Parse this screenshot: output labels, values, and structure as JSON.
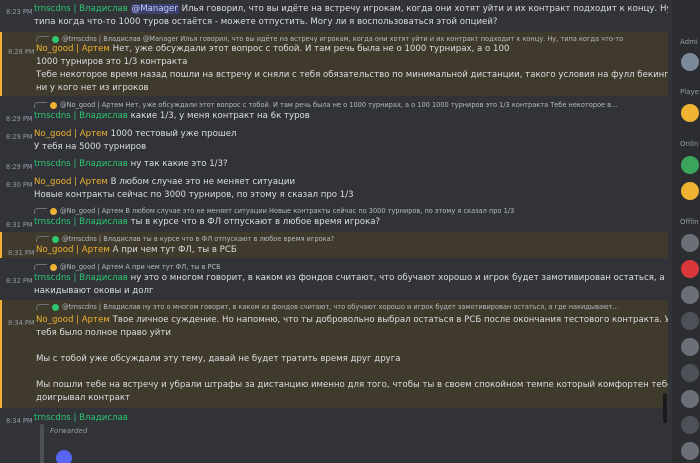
{
  "messages": [
    {
      "time": "8:23 PM",
      "author": "trnscdns | Владислав",
      "lines": [
        "Илья говорил, что вы идёте на встречу игрокам, когда они хотят уйти и их контракт подходит к концу. Ну,",
        "типа когда что-то 1000 туров остаётся - можете отпустить. Могу ли я воспользоваться этой опцией?"
      ],
      "mention": "@Manager"
    },
    {
      "time": "8:28 PM",
      "author": "No_good | Артем",
      "reply": "@trnscdns | Владислав @Manager Илья говорил, что вы идёте на встречу игрокам, когда они хотят уйти и их контракт подходит к концу. Ну, типа когда что-то",
      "lines": [
        "Нет, уже обсуждали этот вопрос с тобой. И там речь была не о 1000 турнирах, а о 100",
        "1000 турниров это 1/3 контракта",
        "Тебе некоторое время назад пошли на встречу и сняли с тебя обязательство по минимальной дистанции, такого условия на фулл бекинге",
        "ни у кого нет из игроков"
      ]
    },
    {
      "time": "8:29 PM",
      "author": "trnscdns | Владислав",
      "reply": "@No_good | Артем Нет, уже обсуждали этот вопрос с тобой. И там речь была не о 1000 турнирах, а о 100 1000 турниров это 1/3 контракта Тебе некоторое в...",
      "lines": [
        "какие 1/3, у меня контракт на 6к туров"
      ]
    },
    {
      "time": "8:29 PM",
      "author": "No_good | Артем",
      "lines": [
        "1000 тестовый уже прошел",
        "У тебя на 5000 турниров"
      ]
    },
    {
      "time": "8:29 PM",
      "author": "trnscdns | Владислав",
      "lines": [
        "ну  так какие это 1/3?"
      ]
    },
    {
      "time": "8:30 PM",
      "author": "No_good | Артем",
      "lines": [
        "В любом случае это не меняет ситуации",
        "Новые контракты сейчас по 3000 турниров, по этому я сказал про 1/3"
      ]
    },
    {
      "time": "8:31 PM",
      "author": "trnscdns | Владислав",
      "reply": "@No_good | Артем В любом случае это не меняет ситуации Новые контракты сейчас по 3000 турниров, по этому я сказал про 1/3",
      "lines": [
        "ты в курсе что в ФЛ отпускают в любое время игрока?"
      ]
    },
    {
      "time": "8:31 PM",
      "author": "No_good | Артем",
      "reply": "@trnscdns | Владислав ты в курсе что в ФЛ отпускают в любое время игрока?",
      "lines": [
        "А при чем тут ФЛ, ты в РСБ"
      ]
    },
    {
      "time": "8:32 PM",
      "author": "trnscdns | Владислав",
      "reply": "@No_good | Артем А при чем тут ФЛ, ты в РСБ",
      "lines": [
        "ну это о  многом говорит, в каком из фондов считают, что обучают хорошо и игрок будет замотивирован остаться, а где",
        "накидывают оковы и долг"
      ]
    },
    {
      "time": "8:34 PM",
      "author": "No_good | Артем",
      "reply": "@trnscdns | Владислав ну это о  многом говорит, в каком из фондов считают, что обучают хорошо и игрок будет замотивирован остаться, а где накидывают...",
      "lines": [
        "Твое личное суждение. Но напомню, что ты добровольно выбрал остаться в РСБ после окончания тестового контракта. У",
        "тебя было полное право уйти",
        "",
        "Мы с тобой уже обсуждали эту тему, давай не будет тратить время друг друга",
        "",
        "Мы пошли тебе на встречу и убрали штрафы за дистанцию именно для того, чтобы ты в своем спокойном темпе который комфортен тебе",
        "доигрывал контракт"
      ]
    },
    {
      "time": "8:34 PM",
      "author": "trnscdns | Владислав",
      "lines": []
    }
  ],
  "forwarded_label": "Forwarded",
  "sidebar": {
    "admin": "Admi",
    "players": "Playe",
    "online": "Onlin",
    "offline": "Offlin"
  },
  "colors": {
    "green_name": "#2dc770",
    "orange_name": "#f0b232",
    "bg": "#313338"
  }
}
